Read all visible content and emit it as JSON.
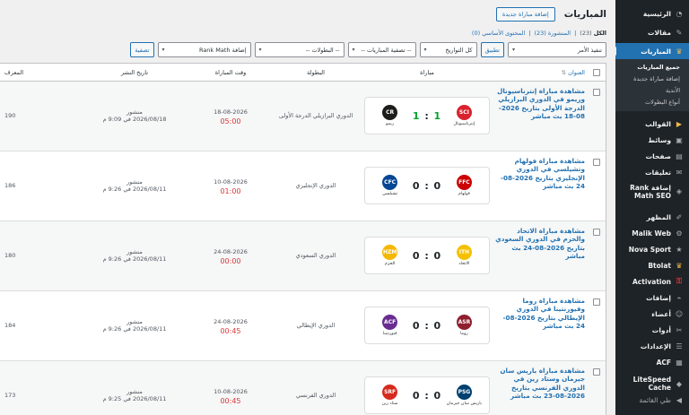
{
  "sidebar": {
    "items": [
      {
        "label": "الرئيسية",
        "icon": "dashboard-icon"
      },
      {
        "label": "مقالات",
        "icon": "pin-icon"
      },
      {
        "label": "المباريات",
        "icon": "trophy-icon"
      },
      {
        "label": "القوالب",
        "icon": "play-icon"
      },
      {
        "label": "وسائط",
        "icon": "media-icon"
      },
      {
        "label": "صفحات",
        "icon": "pages-icon"
      },
      {
        "label": "تعليقات",
        "icon": "comments-icon"
      },
      {
        "label": "إضافة Rank Math SEO",
        "icon": "rankmath-icon"
      },
      {
        "label": "المظهر",
        "icon": "brush-icon"
      },
      {
        "label": "Malik Web",
        "icon": "gear-icon"
      },
      {
        "label": "Nova Sport",
        "icon": "star-icon"
      },
      {
        "label": "Btolat",
        "icon": "trophy-icon"
      },
      {
        "label": "Activation",
        "icon": "key-icon"
      },
      {
        "label": "إضافات",
        "icon": "plugin-icon"
      },
      {
        "label": "أعضاء",
        "icon": "user-icon"
      },
      {
        "label": "أدوات",
        "icon": "wrench-icon"
      },
      {
        "label": "الإعدادات",
        "icon": "settings-icon"
      },
      {
        "label": "ACF",
        "icon": "grid-icon"
      },
      {
        "label": "LiteSpeed Cache",
        "icon": "diamond-icon"
      },
      {
        "label": "طي القائمة",
        "icon": "collapse-icon"
      }
    ],
    "submenu": [
      "جميع المباريات",
      "إضافة مباراة جديدة",
      "الأندية",
      "أنواع البطولات"
    ]
  },
  "header": {
    "title": "المباريات",
    "add_new": "إضافة مباراة جديدة"
  },
  "views": {
    "all": "الكل",
    "all_count": "(23)",
    "sep1": "|",
    "published": "المنشورة (23)",
    "sep2": "|",
    "cornerstone": "المحتوى الأساسي (0)"
  },
  "filters": {
    "bulk_action": "تنفيذ الأمر",
    "apply": "تطبيق",
    "dates": "كل التواريخ",
    "match_filter": "-- تصفية المباريات --",
    "leagues": "-- البطولات --",
    "rankmath": "إضافة Rank Math",
    "filter_button": "تصفية"
  },
  "table": {
    "columns": {
      "title": "العنوان",
      "match": "مباراة",
      "league": "البطولة",
      "time": "وقت المباراة",
      "published": "تاريخ النشر",
      "id": "المعرف"
    },
    "rows": [
      {
        "title": "مشاهدة مباراة إنترناسيونال وريمو في الدوري البرازيلي الدرجة الأولى بتاريخ 2026-08-18 بث مباشر",
        "home": "إنترناسيونال",
        "away": "ريمو",
        "home_score": "1",
        "away_score": "1",
        "home_color": "#d9232e",
        "away_color": "#1d1d1b",
        "home_abbr": "SCI",
        "away_abbr": "CR",
        "league": "الدوري البرازيلي الدرجة الأولى",
        "date": "18-08-2026",
        "time": "05:00",
        "status": "منشور",
        "pub": "2026/08/18 في 9:09 م",
        "id": "190"
      },
      {
        "title": "مشاهدة مباراة فولهام وتشيلسي في الدوري الإنجليزي بتاريخ 2026-08-24 بث مباشر",
        "home": "فولهام",
        "away": "تشيلسي",
        "home_score": "0",
        "away_score": "0",
        "home_color": "#cc0000",
        "away_color": "#034694",
        "home_abbr": "FFC",
        "away_abbr": "CFC",
        "league": "الدوري الإنجليزي",
        "date": "10-08-2026",
        "time": "01:00",
        "status": "منشور",
        "pub": "2026/08/11 في 9:26 م",
        "id": "186"
      },
      {
        "title": "مشاهدة مباراة الاتحاد والحزم في الدوري السعودي بتاريخ 2026-08-24 بث مباشر",
        "home": "الاتحاد",
        "away": "الحزم",
        "home_score": "0",
        "away_score": "0",
        "home_color": "#f5c000",
        "away_color": "#f5b800",
        "home_abbr": "ITH",
        "away_abbr": "HZM",
        "league": "الدوري السعودي",
        "date": "24-08-2026",
        "time": "00:00",
        "status": "منشور",
        "pub": "2026/08/11 في 9:26 م",
        "id": "180"
      },
      {
        "title": "مشاهدة مباراة روما وفيورنتينا في الدوري الإيطالي بتاريخ 2026-08-24 بث مباشر",
        "home": "روما",
        "away": "فيورنتينا",
        "home_score": "0",
        "away_score": "0",
        "home_color": "#8e1f2f",
        "away_color": "#6a2c91",
        "home_abbr": "ASR",
        "away_abbr": "ACF",
        "league": "الدوري الإيطالي",
        "date": "24-08-2026",
        "time": "00:45",
        "status": "منشور",
        "pub": "2026/08/11 في 9:26 م",
        "id": "184"
      },
      {
        "title": "مشاهدة مباراة باريس سان جيرمان وستاد رين في الدوري الفرنسي بتاريخ 2026-08-23 بث مباشر",
        "home": "باريس سان جيرمان",
        "away": "ستاد رين",
        "home_score": "0",
        "away_score": "0",
        "home_color": "#004170",
        "away_color": "#d52b1e",
        "home_abbr": "PSG",
        "away_abbr": "SRF",
        "league": "الدوري الفرنسي",
        "date": "10-08-2026",
        "time": "00:45",
        "status": "منشور",
        "pub": "2026/08/11 في 9:25 م",
        "id": "173"
      }
    ]
  }
}
